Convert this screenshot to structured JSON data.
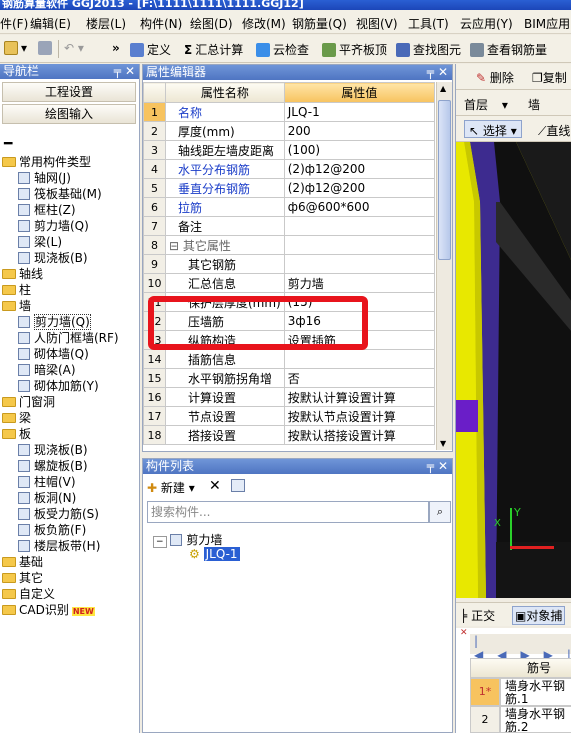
{
  "titlebar": {
    "text": "钢筋算量软件 GGJ2013 - [F:\\1111\\1111\\1111.GGJ12]"
  },
  "menu": [
    "件(F)",
    "编辑(E)",
    "楼层(L)",
    "构件(N)",
    "绘图(D)",
    "修改(M)",
    "钢筋量(Q)",
    "视图(V)",
    "工具(T)",
    "云应用(Y)",
    "BIM应用(I)"
  ],
  "toolbar": {
    "define": "定义",
    "sum_calc": "汇总计算",
    "cloud_check": "云检查",
    "flat_slab": "平齐板顶",
    "find_element": "查找图元",
    "view_rebar": "查看钢筋量"
  },
  "nav": {
    "title": "导航栏",
    "btn_project": "工程设置",
    "btn_draw": "绘图输入",
    "tree": [
      {
        "label": "常用构件类型",
        "kind": "folder",
        "indent": 0
      },
      {
        "label": "轴网(J)",
        "kind": "item",
        "indent": 1
      },
      {
        "label": "筏板基础(M)",
        "kind": "item",
        "indent": 1
      },
      {
        "label": "框柱(Z)",
        "kind": "item",
        "indent": 1
      },
      {
        "label": "剪力墙(Q)",
        "kind": "item",
        "indent": 1
      },
      {
        "label": "梁(L)",
        "kind": "item",
        "indent": 1
      },
      {
        "label": "现浇板(B)",
        "kind": "item",
        "indent": 1
      },
      {
        "label": "轴线",
        "kind": "folder",
        "indent": 0
      },
      {
        "label": "柱",
        "kind": "folder",
        "indent": 0
      },
      {
        "label": "墙",
        "kind": "folder",
        "indent": 0
      },
      {
        "label": "剪力墙(Q)",
        "kind": "item",
        "indent": 1,
        "selected": true
      },
      {
        "label": "人防门框墙(RF)",
        "kind": "item",
        "indent": 1
      },
      {
        "label": "砌体墙(Q)",
        "kind": "item",
        "indent": 1
      },
      {
        "label": "暗梁(A)",
        "kind": "item",
        "indent": 1
      },
      {
        "label": "砌体加筋(Y)",
        "kind": "item",
        "indent": 1
      },
      {
        "label": "门窗洞",
        "kind": "folder",
        "indent": 0
      },
      {
        "label": "梁",
        "kind": "folder",
        "indent": 0
      },
      {
        "label": "板",
        "kind": "folder",
        "indent": 0
      },
      {
        "label": "现浇板(B)",
        "kind": "item",
        "indent": 1
      },
      {
        "label": "螺旋板(B)",
        "kind": "item",
        "indent": 1
      },
      {
        "label": "柱帽(V)",
        "kind": "item",
        "indent": 1
      },
      {
        "label": "板洞(N)",
        "kind": "item",
        "indent": 1
      },
      {
        "label": "板受力筋(S)",
        "kind": "item",
        "indent": 1
      },
      {
        "label": "板负筋(F)",
        "kind": "item",
        "indent": 1
      },
      {
        "label": "楼层板带(H)",
        "kind": "item",
        "indent": 1
      },
      {
        "label": "基础",
        "kind": "folder",
        "indent": 0
      },
      {
        "label": "其它",
        "kind": "folder",
        "indent": 0
      },
      {
        "label": "自定义",
        "kind": "folder",
        "indent": 0
      },
      {
        "label": "CAD识别",
        "kind": "folder",
        "indent": 0,
        "badge": "NEW"
      }
    ]
  },
  "props": {
    "title": "属性编辑器",
    "col_name": "属性名称",
    "col_value": "属性值",
    "rows": [
      {
        "no": "1",
        "name": "名称",
        "value": "JLQ-1",
        "style": "blue"
      },
      {
        "no": "2",
        "name": "厚度(mm)",
        "value": "200",
        "style": ""
      },
      {
        "no": "3",
        "name": "轴线距左墙皮距离",
        "value": "(100)",
        "style": ""
      },
      {
        "no": "4",
        "name": "水平分布钢筋",
        "value": "(2)ф12@200",
        "style": "blue"
      },
      {
        "no": "5",
        "name": "垂直分布钢筋",
        "value": "(2)ф12@200",
        "style": "blue"
      },
      {
        "no": "6",
        "name": "拉筋",
        "value": "ф6@600*600",
        "style": "blue"
      },
      {
        "no": "7",
        "name": "备注",
        "value": "",
        "style": ""
      },
      {
        "no": "8",
        "name": "其它属性",
        "value": "",
        "style": "grey"
      },
      {
        "no": "9",
        "name": "其它钢筋",
        "value": "",
        "style": ""
      },
      {
        "no": "10",
        "name": "汇总信息",
        "value": "剪力墙",
        "style": ""
      },
      {
        "no": "11",
        "name": "保护层厚度(mm)",
        "value": "(15)",
        "style": ""
      },
      {
        "no": "12",
        "name": "压墙筋",
        "value": "3ф16",
        "style": ""
      },
      {
        "no": "13",
        "name": "纵筋构造",
        "value": "设置插筋",
        "style": ""
      },
      {
        "no": "14",
        "name": "插筋信息",
        "value": "",
        "style": ""
      },
      {
        "no": "15",
        "name": "水平钢筋拐角增",
        "value": "否",
        "style": ""
      },
      {
        "no": "16",
        "name": "计算设置",
        "value": "按默认计算设置计算",
        "style": ""
      },
      {
        "no": "17",
        "name": "节点设置",
        "value": "按默认节点设置计算",
        "style": ""
      },
      {
        "no": "18",
        "name": "搭接设置",
        "value": "按默认搭接设置计算",
        "style": ""
      }
    ]
  },
  "complist": {
    "title": "构件列表",
    "new_btn": "新建",
    "search_placeholder": "搜索构件...",
    "group": "剪力墙",
    "item": "JLQ-1"
  },
  "right": {
    "delete_btn": "删除",
    "copy_btn": "复制",
    "floor": "首层",
    "type": "墙",
    "select_btn": "选择",
    "line_btn": "直线",
    "ortho_btn": "正交",
    "snap_btn": "对象捕",
    "grid_header": "筋号",
    "grid_rows": [
      {
        "no": "1*",
        "name": "墙身水平钢筋.1"
      },
      {
        "no": "2",
        "name": "墙身水平钢筋.2"
      }
    ],
    "axis_x": "X",
    "axis_y": "Y"
  },
  "colors": {
    "accent": "#4f75c2",
    "highlight": "#e8141c",
    "header": "#f7c35f",
    "wall": "#3d2b8f"
  }
}
